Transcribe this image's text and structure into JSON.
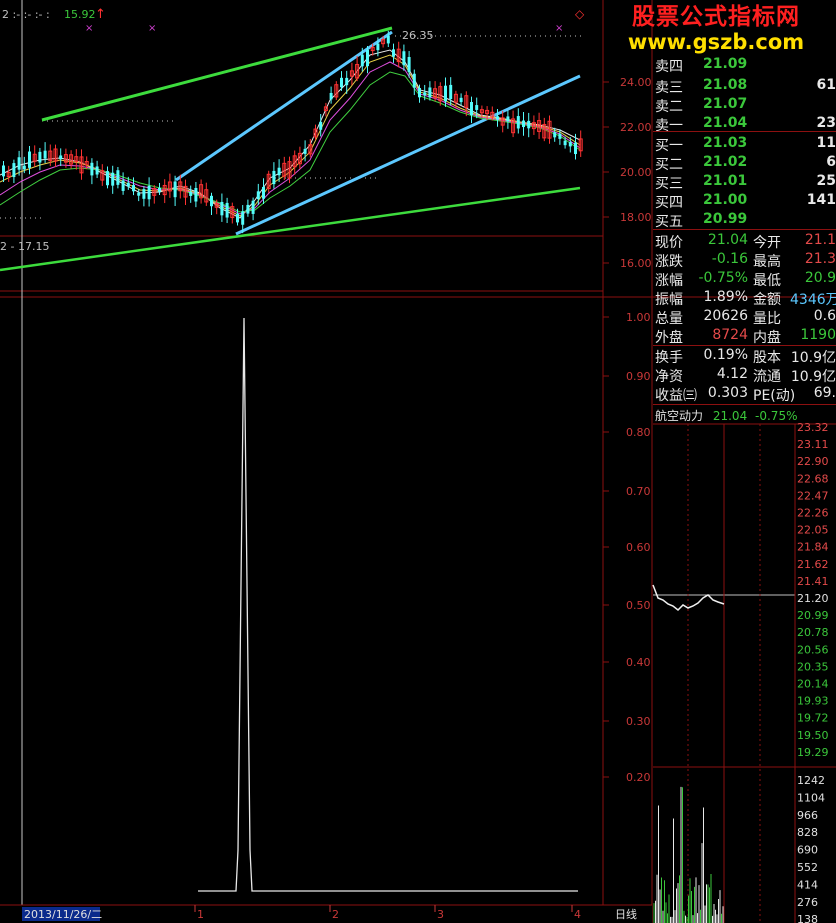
{
  "top_chart": {
    "header_left": "2 :- :- :- :",
    "header_value": "15.92",
    "high_label": "26.35",
    "low_label": "2 - 17.15",
    "price_axis": [
      "24.00",
      "22.00",
      "20.00",
      "18.00",
      "16.00"
    ]
  },
  "osc_chart": {
    "axis": [
      "1.00",
      "0.90",
      "0.80",
      "0.70",
      "0.60",
      "0.50",
      "0.40",
      "0.30",
      "0.20"
    ]
  },
  "bottom_bar": {
    "date": "2013/11/26/二",
    "month_marks": [
      "1",
      "2",
      "3",
      "4"
    ],
    "period": "日线"
  },
  "watermark": {
    "line1": "股票公式指标网",
    "line2": "www.gszb.com"
  },
  "order_book": {
    "sell": [
      {
        "label": "卖四",
        "price": "21.09",
        "vol": ""
      },
      {
        "label": "卖三",
        "price": "21.08",
        "vol": "61"
      },
      {
        "label": "卖二",
        "price": "21.07",
        "vol": ""
      },
      {
        "label": "卖一",
        "price": "21.04",
        "vol": "23"
      }
    ],
    "buy": [
      {
        "label": "买一",
        "price": "21.03",
        "vol": "11"
      },
      {
        "label": "买二",
        "price": "21.02",
        "vol": "6"
      },
      {
        "label": "买三",
        "price": "21.01",
        "vol": "25"
      },
      {
        "label": "买四",
        "price": "21.00",
        "vol": "141"
      },
      {
        "label": "买五",
        "price": "20.99",
        "vol": ""
      }
    ]
  },
  "quote": [
    {
      "l1": "现价",
      "v1": "21.04",
      "l2": "今开",
      "v2": "21.1"
    },
    {
      "l1": "涨跌",
      "v1": "-0.16",
      "l2": "最高",
      "v2": "21.3"
    },
    {
      "l1": "涨幅",
      "v1": "-0.75%",
      "l2": "最低",
      "v2": "20.9"
    },
    {
      "l1": "振幅",
      "v1": "1.89%",
      "l2": "金额",
      "v2": "4346万"
    },
    {
      "l1": "总量",
      "v1": "20626",
      "l2": "量比",
      "v2": "0.6"
    },
    {
      "l1": "外盘",
      "v1": "8724",
      "l2": "内盘",
      "v2": "1190"
    }
  ],
  "fundamentals": [
    {
      "l1": "换手",
      "v1": "0.19%",
      "l2": "股本",
      "v2": "10.9亿"
    },
    {
      "l1": "净资",
      "v1": "4.12",
      "l2": "流通",
      "v2": "10.9亿"
    },
    {
      "l1": "收益㈢",
      "v1": "0.303",
      "l2": "PE(动)",
      "v2": "69."
    }
  ],
  "mini_chart": {
    "name": "航空动力",
    "price": "21.04",
    "change": "-0.75%",
    "price_scale": [
      "23.32",
      "23.11",
      "22.90",
      "22.68",
      "22.47",
      "22.26",
      "22.05",
      "21.84",
      "21.62",
      "21.41",
      "21.20",
      "20.99",
      "20.78",
      "20.56",
      "20.35",
      "20.14",
      "19.93",
      "19.72",
      "19.50",
      "19.29"
    ],
    "vol_scale": [
      "1242",
      "1104",
      "966",
      "828",
      "690",
      "552",
      "414",
      "276",
      "138"
    ]
  },
  "colors": {
    "up": "#ff3232",
    "down": "#54fcfc",
    "channel_green": "#3ddc3d",
    "channel_blue": "#5cc8ff",
    "grid_red": "#8c1010"
  }
}
